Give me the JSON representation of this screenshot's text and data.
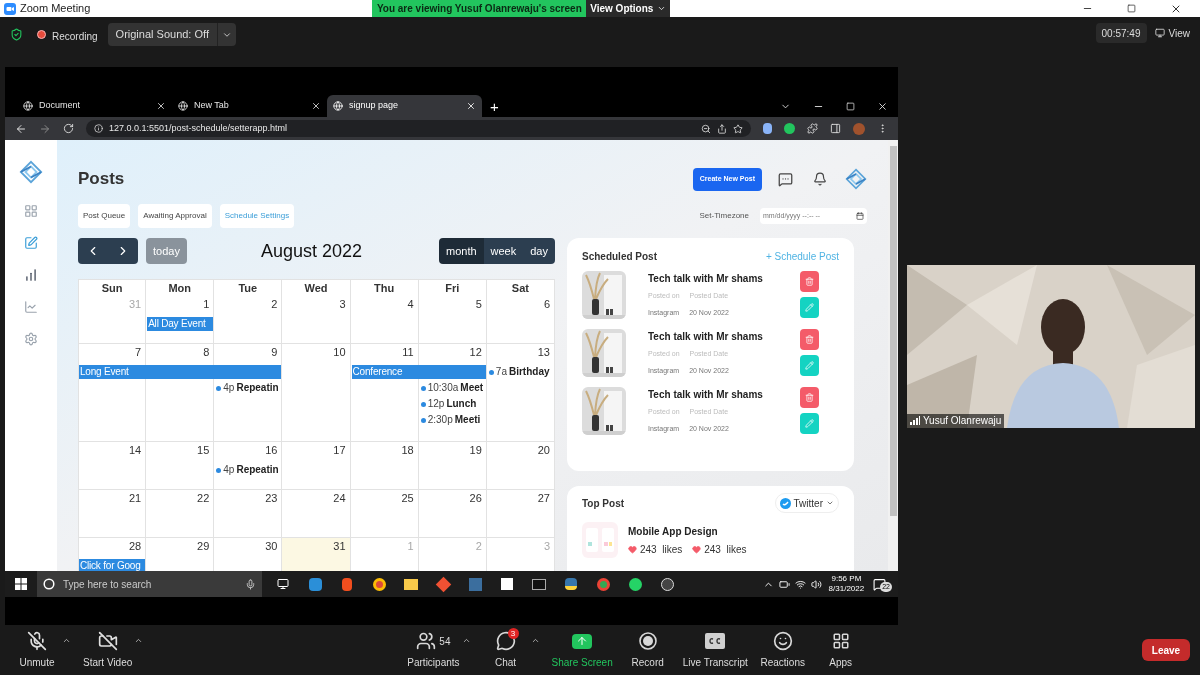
{
  "zoom": {
    "title": "Zoom Meeting",
    "banner": "You are viewing Yusuf Olanrewaju's screen",
    "view_options": "View Options",
    "recording": "Recording",
    "sound": "Original Sound: Off",
    "timer": "00:57:49",
    "view": "View"
  },
  "browser": {
    "tabs": [
      {
        "label": "Document",
        "selected": false
      },
      {
        "label": "New Tab",
        "selected": false
      },
      {
        "label": "signup page",
        "selected": true
      }
    ],
    "new_tab": "+",
    "url": "127.0.0.1:5501/post-schedule/setterapp.html"
  },
  "app": {
    "sidebar": [
      {
        "kind": "grid",
        "selected": false
      },
      {
        "kind": "edit",
        "selected": true
      },
      {
        "kind": "bars",
        "selected": false
      },
      {
        "kind": "chart",
        "selected": false
      },
      {
        "kind": "settings",
        "selected": false
      }
    ],
    "title": "Posts",
    "create_button": "Create New Post",
    "tabs": [
      {
        "label": "Post Queue",
        "selected": false
      },
      {
        "label": "Awaiting Approval",
        "selected": false
      },
      {
        "label": "Schedule Settings",
        "selected": true
      }
    ],
    "timezone_label": "Set-Timezone",
    "timezone_placeholder": "mm/dd/yyyy --:-- --"
  },
  "calendar": {
    "today_button": "today",
    "title": "August 2022",
    "views": [
      {
        "label": "month",
        "selected": true
      },
      {
        "label": "week",
        "selected": false
      },
      {
        "label": "day",
        "selected": false
      }
    ],
    "weekdays": [
      "Sun",
      "Mon",
      "Tue",
      "Wed",
      "Thu",
      "Fri",
      "Sat"
    ],
    "weeks": [
      {
        "days": [
          {
            "label": "31",
            "muted": true,
            "today": false
          },
          {
            "label": "1",
            "muted": false,
            "today": false,
            "events": [
              {
                "kind": "bar",
                "title": "All Day Event"
              }
            ]
          },
          {
            "label": "2",
            "muted": false,
            "today": false
          },
          {
            "label": "3",
            "muted": false,
            "today": false
          },
          {
            "label": "4",
            "muted": false,
            "today": false
          },
          {
            "label": "5",
            "muted": false,
            "today": false
          },
          {
            "label": "6",
            "muted": false,
            "today": false
          }
        ]
      },
      {
        "days": [
          {
            "label": "7",
            "muted": false,
            "today": false,
            "events": [
              {
                "kind": "bar",
                "title": "Long Event"
              }
            ]
          },
          {
            "label": "8",
            "muted": false,
            "today": false,
            "events": [
              {
                "kind": "continued"
              }
            ]
          },
          {
            "label": "9",
            "muted": false,
            "today": false,
            "events": [
              {
                "kind": "continued"
              },
              {
                "kind": "dot",
                "time": "4p",
                "title": "Repeatin"
              }
            ]
          },
          {
            "label": "10",
            "muted": false,
            "today": false
          },
          {
            "label": "11",
            "muted": false,
            "today": false,
            "events": [
              {
                "kind": "bar",
                "title": "Conference"
              }
            ]
          },
          {
            "label": "12",
            "muted": false,
            "today": false,
            "events": [
              {
                "kind": "continued"
              },
              {
                "kind": "dot",
                "time": "10:30a",
                "title": "Meet"
              },
              {
                "kind": "dot",
                "time": "12p",
                "title": "Lunch"
              },
              {
                "kind": "dot",
                "time": "2:30p",
                "title": "Meeti"
              }
            ]
          },
          {
            "label": "13",
            "muted": false,
            "today": false,
            "events": [
              {
                "kind": "dot",
                "time": "7a",
                "title": "Birthday"
              }
            ]
          }
        ]
      },
      {
        "days": [
          {
            "label": "14",
            "muted": false,
            "today": false
          },
          {
            "label": "15",
            "muted": false,
            "today": false
          },
          {
            "label": "16",
            "muted": false,
            "today": false,
            "events": [
              {
                "kind": "dot",
                "time": "4p",
                "title": "Repeatin"
              }
            ]
          },
          {
            "label": "17",
            "muted": false,
            "today": false
          },
          {
            "label": "18",
            "muted": false,
            "today": false
          },
          {
            "label": "19",
            "muted": false,
            "today": false
          },
          {
            "label": "20",
            "muted": false,
            "today": false
          }
        ]
      },
      {
        "days": [
          {
            "label": "21",
            "muted": false,
            "today": false
          },
          {
            "label": "22",
            "muted": false,
            "today": false
          },
          {
            "label": "23",
            "muted": false,
            "today": false
          },
          {
            "label": "24",
            "muted": false,
            "today": false
          },
          {
            "label": "25",
            "muted": false,
            "today": false
          },
          {
            "label": "26",
            "muted": false,
            "today": false
          },
          {
            "label": "27",
            "muted": false,
            "today": false
          }
        ]
      },
      {
        "days": [
          {
            "label": "28",
            "muted": false,
            "today": false,
            "events": [
              {
                "kind": "bar",
                "title": "Click for Goog"
              }
            ]
          },
          {
            "label": "29",
            "muted": false,
            "today": false
          },
          {
            "label": "30",
            "muted": false,
            "today": false
          },
          {
            "label": "31",
            "muted": false,
            "today": true
          },
          {
            "label": "1",
            "muted": true,
            "today": false
          },
          {
            "label": "2",
            "muted": true,
            "today": false
          },
          {
            "label": "3",
            "muted": true,
            "today": false
          }
        ]
      }
    ]
  },
  "scheduled": {
    "title": "Scheduled Post",
    "action": "+ Schedule Post",
    "posts": [
      {
        "title": "Tech talk with Mr shams",
        "posted_on_label": "Posted on",
        "date_label": "Posted Date",
        "platform": "Instagram",
        "date": "20 Nov 2022"
      },
      {
        "title": "Tech talk with Mr shams",
        "posted_on_label": "Posted on",
        "date_label": "Posted Date",
        "platform": "Instagram",
        "date": "20 Nov 2022"
      },
      {
        "title": "Tech talk with Mr shams",
        "posted_on_label": "Posted on",
        "date_label": "Posted Date",
        "platform": "Instagram",
        "date": "20 Nov 2022"
      }
    ]
  },
  "top_post": {
    "title": "Top Post",
    "platform": "Twitter",
    "posts": [
      {
        "title": "Mobile App Design",
        "likes": [
          "243  likes",
          "243  likes"
        ]
      }
    ]
  },
  "taskbar": {
    "search_placeholder": "Type here to search",
    "time": "9:56 PM",
    "date": "8/31/2022",
    "notifications": "22"
  },
  "video": {
    "name": "Yusuf Olanrewaju"
  },
  "toolbar": {
    "controls": [
      {
        "kind": "mic",
        "label": "Unmute"
      },
      {
        "kind": "video",
        "label": "Start Video"
      },
      {
        "kind": "participants",
        "label": "Participants",
        "count": "54"
      },
      {
        "kind": "chat",
        "label": "Chat",
        "badge": "3"
      },
      {
        "kind": "share",
        "label": "Share Screen"
      },
      {
        "kind": "record",
        "label": "Record"
      },
      {
        "kind": "cc",
        "label": "Live Transcript"
      },
      {
        "kind": "reactions",
        "label": "Reactions"
      },
      {
        "kind": "apps",
        "label": "Apps"
      }
    ],
    "leave": "Leave"
  }
}
